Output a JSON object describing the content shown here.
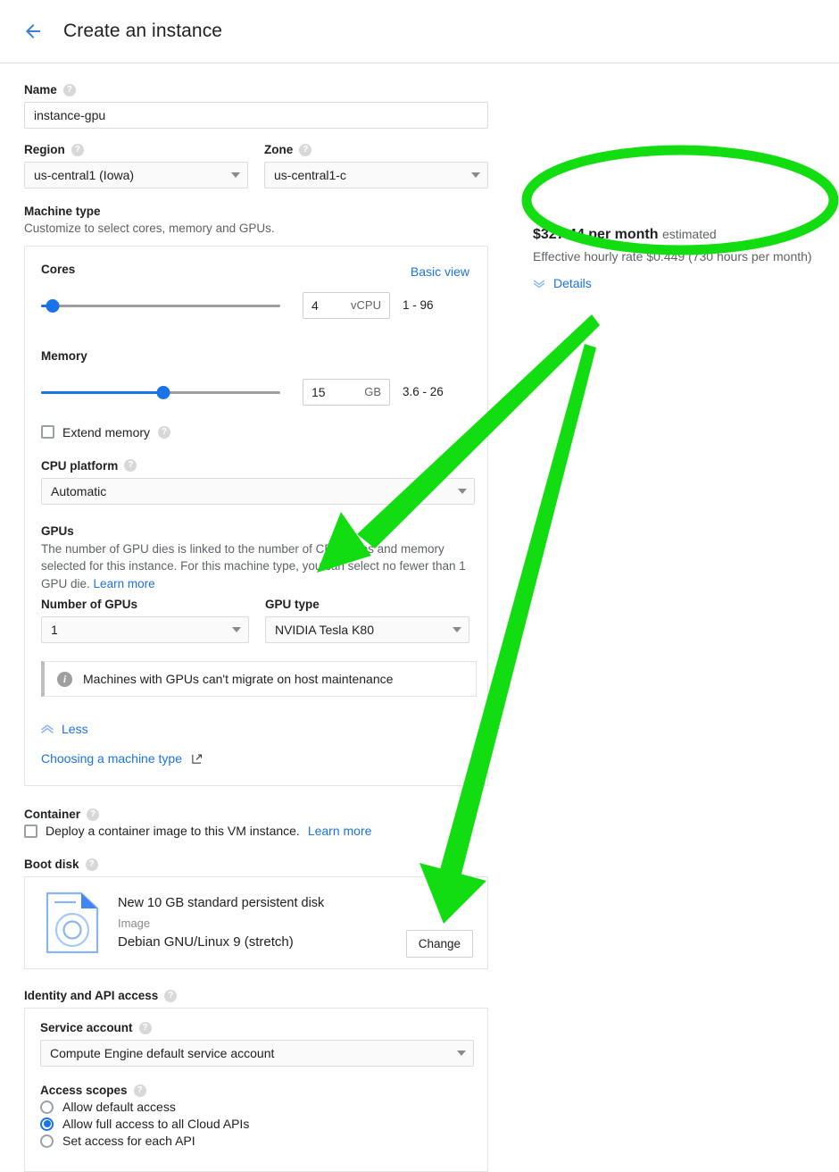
{
  "header": {
    "title": "Create an instance",
    "back_icon": "arrow-left-icon"
  },
  "name_section": {
    "label": "Name",
    "value": "instance-gpu",
    "help": "?"
  },
  "region_section": {
    "label": "Region",
    "value": "us-central1 (Iowa)"
  },
  "zone_section": {
    "label": "Zone",
    "value": "us-central1-c"
  },
  "machine_type": {
    "label": "Machine type",
    "description": "Customize to select cores, memory and GPUs.",
    "basic_view_link": "Basic view",
    "cores": {
      "label": "Cores",
      "value": "4",
      "unit": "vCPU",
      "range": "1 - 96",
      "slider_percent": 5
    },
    "memory": {
      "label": "Memory",
      "value": "15",
      "unit": "GB",
      "range": "3.6 - 26",
      "slider_percent": 51
    },
    "extend_memory": {
      "label": "Extend memory",
      "checked": false
    },
    "cpu_platform": {
      "label": "CPU platform",
      "value": "Automatic"
    },
    "gpus": {
      "label": "GPUs",
      "description": "The number of GPU dies is linked to the number of CPU cores and memory selected for this instance. For this machine type, you can select no fewer than 1 GPU die.",
      "learn_more": "Learn more",
      "number_label": "Number of GPUs",
      "number_value": "1",
      "type_label": "GPU type",
      "type_value": "NVIDIA Tesla K80"
    },
    "info_notice": "Machines with GPUs can't migrate on host maintenance",
    "less_link": "Less",
    "choosing_link": "Choosing a machine type"
  },
  "container": {
    "label": "Container",
    "checkbox_text": "Deploy a container image to this VM instance.",
    "learn_more": "Learn more",
    "checked": false
  },
  "boot_disk": {
    "label": "Boot disk",
    "disk_title": "New 10 GB standard persistent disk",
    "image_label": "Image",
    "image_value": "Debian GNU/Linux 9 (stretch)",
    "change_button": "Change"
  },
  "identity": {
    "label": "Identity and API access",
    "service_account": {
      "label": "Service account",
      "value": "Compute Engine default service account"
    },
    "access_scopes": {
      "label": "Access scopes",
      "options": [
        {
          "label": "Allow default access",
          "selected": false
        },
        {
          "label": "Allow full access to all Cloud APIs",
          "selected": true
        },
        {
          "label": "Set access for each API",
          "selected": false
        }
      ]
    }
  },
  "pricing": {
    "amount": "$327.44 per month",
    "estimated_suffix": "estimated",
    "hourly_rate": "Effective hourly rate $0.449 (730 hours per month)",
    "details_link": "Details"
  },
  "annotations": {
    "highlight_color": "#11dd11",
    "ellipse_target": "pricing-panel",
    "arrow_1_target": "gpu-type-label",
    "arrow_2_target": "boot-disk-change-button"
  },
  "colors": {
    "accent_blue": "#1a73e8",
    "text_primary": "#202124",
    "text_secondary": "#5f6368",
    "border": "#e4e4e4",
    "annotation_green": "#11dd11"
  }
}
